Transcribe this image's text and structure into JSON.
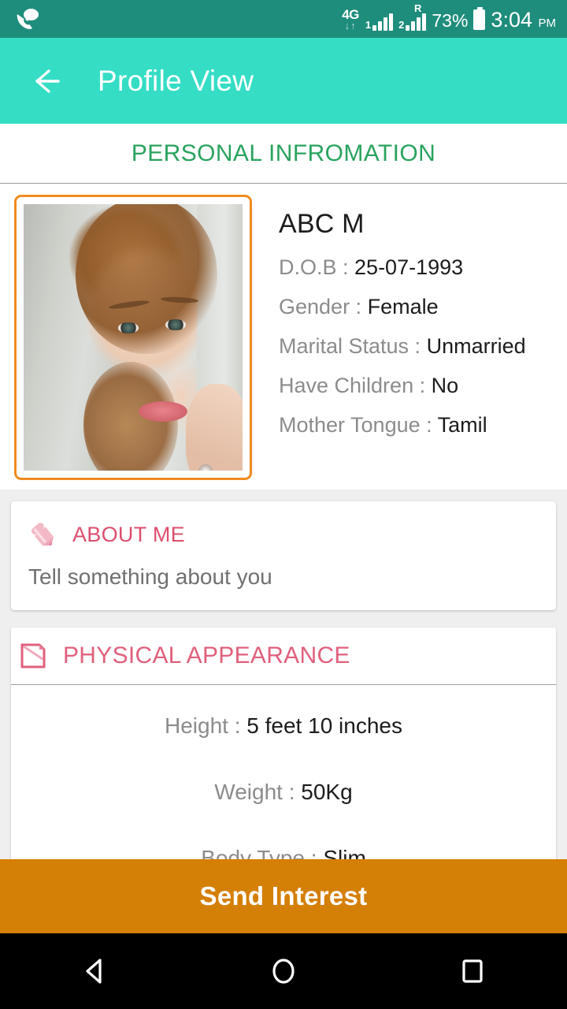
{
  "status_bar": {
    "notification_icon": "call-message-icon",
    "network_type": "4G",
    "data_arrows": "↓↑",
    "sim1_label": "1",
    "sim2_label": "2",
    "roaming_label": "R",
    "battery_percent": "73%",
    "battery_icon": "battery-icon",
    "time": "3:04",
    "ampm": "PM",
    "background": "#1f8d7c"
  },
  "app_bar": {
    "back_icon": "back-arrow-icon",
    "title": "Profile View",
    "background": "#35ddc5",
    "text_color": "#ffffff"
  },
  "section": {
    "title": "PERSONAL INFROMATION",
    "title_color": "#2aa35e"
  },
  "profile": {
    "photo_alt": "profile-photo",
    "photo_border_color": "#ef8b20",
    "name": "ABC  M",
    "fields": [
      {
        "label": "D.O.B :",
        "value": "25-07-1993"
      },
      {
        "label": "Gender :",
        "value": "Female"
      },
      {
        "label": "Marital Status :",
        "value": "Unmarried"
      },
      {
        "label": "Have Children :",
        "value": " No"
      },
      {
        "label": "Mother Tongue :",
        "value": "Tamil"
      }
    ]
  },
  "about_me": {
    "icon": "pencil-icon",
    "title": "ABOUT ME",
    "body": "Tell something about you",
    "title_color": "#dd4f6e"
  },
  "physical_appearance": {
    "icon": "note-page-icon",
    "title": "PHYSICAL APPEARANCE",
    "title_color": "#e0607c",
    "rows": [
      {
        "label": "Height :",
        "value": "5 feet 10 inches"
      },
      {
        "label": "Weight :",
        "value": "50Kg"
      },
      {
        "label": "Body Type :",
        "value": "Slim"
      }
    ]
  },
  "send_interest": {
    "label": "Send Interest",
    "background": "#d47f06",
    "text_color": "#ffffff"
  },
  "nav_bar": {
    "back": "nav-back-icon",
    "home": "nav-home-icon",
    "recents": "nav-recents-icon"
  }
}
